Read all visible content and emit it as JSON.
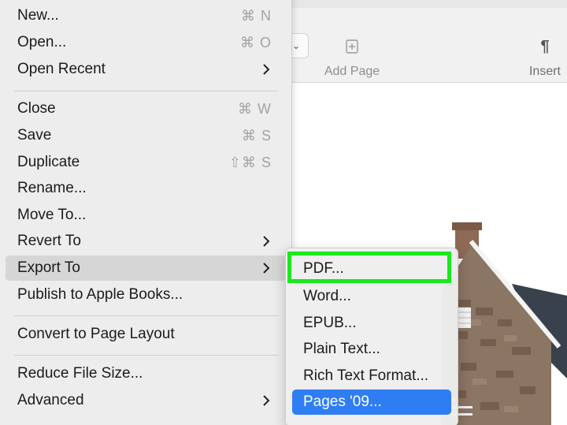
{
  "toolbar": {
    "add_page_label": "Add Page",
    "insert_label": "Insert",
    "icons": [
      "chevron-down-icon",
      "add-page-icon",
      "pilcrow-icon"
    ]
  },
  "file_menu": {
    "new": {
      "label": "New...",
      "shortcut": "⌘ N"
    },
    "open": {
      "label": "Open...",
      "shortcut": "⌘ O"
    },
    "open_recent": {
      "label": "Open Recent"
    },
    "close": {
      "label": "Close",
      "shortcut": "⌘ W"
    },
    "save": {
      "label": "Save",
      "shortcut": "⌘ S"
    },
    "duplicate": {
      "label": "Duplicate",
      "shortcut": "⇧⌘ S"
    },
    "rename": {
      "label": "Rename..."
    },
    "move_to": {
      "label": "Move To..."
    },
    "revert_to": {
      "label": "Revert To"
    },
    "export_to": {
      "label": "Export To"
    },
    "publish": {
      "label": "Publish to Apple Books..."
    },
    "convert": {
      "label": "Convert to Page Layout"
    },
    "reduce": {
      "label": "Reduce File Size..."
    },
    "advanced": {
      "label": "Advanced"
    }
  },
  "export_submenu": {
    "pdf": "PDF...",
    "word": "Word...",
    "epub": "EPUB...",
    "plain_text": "Plain Text...",
    "rich_text": "Rich Text Format...",
    "pages09": "Pages '09..."
  },
  "colors": {
    "selection_blue": "#2f7df3",
    "highlight_green": "#19e81f",
    "hover_gray": "#d6d6d6"
  }
}
